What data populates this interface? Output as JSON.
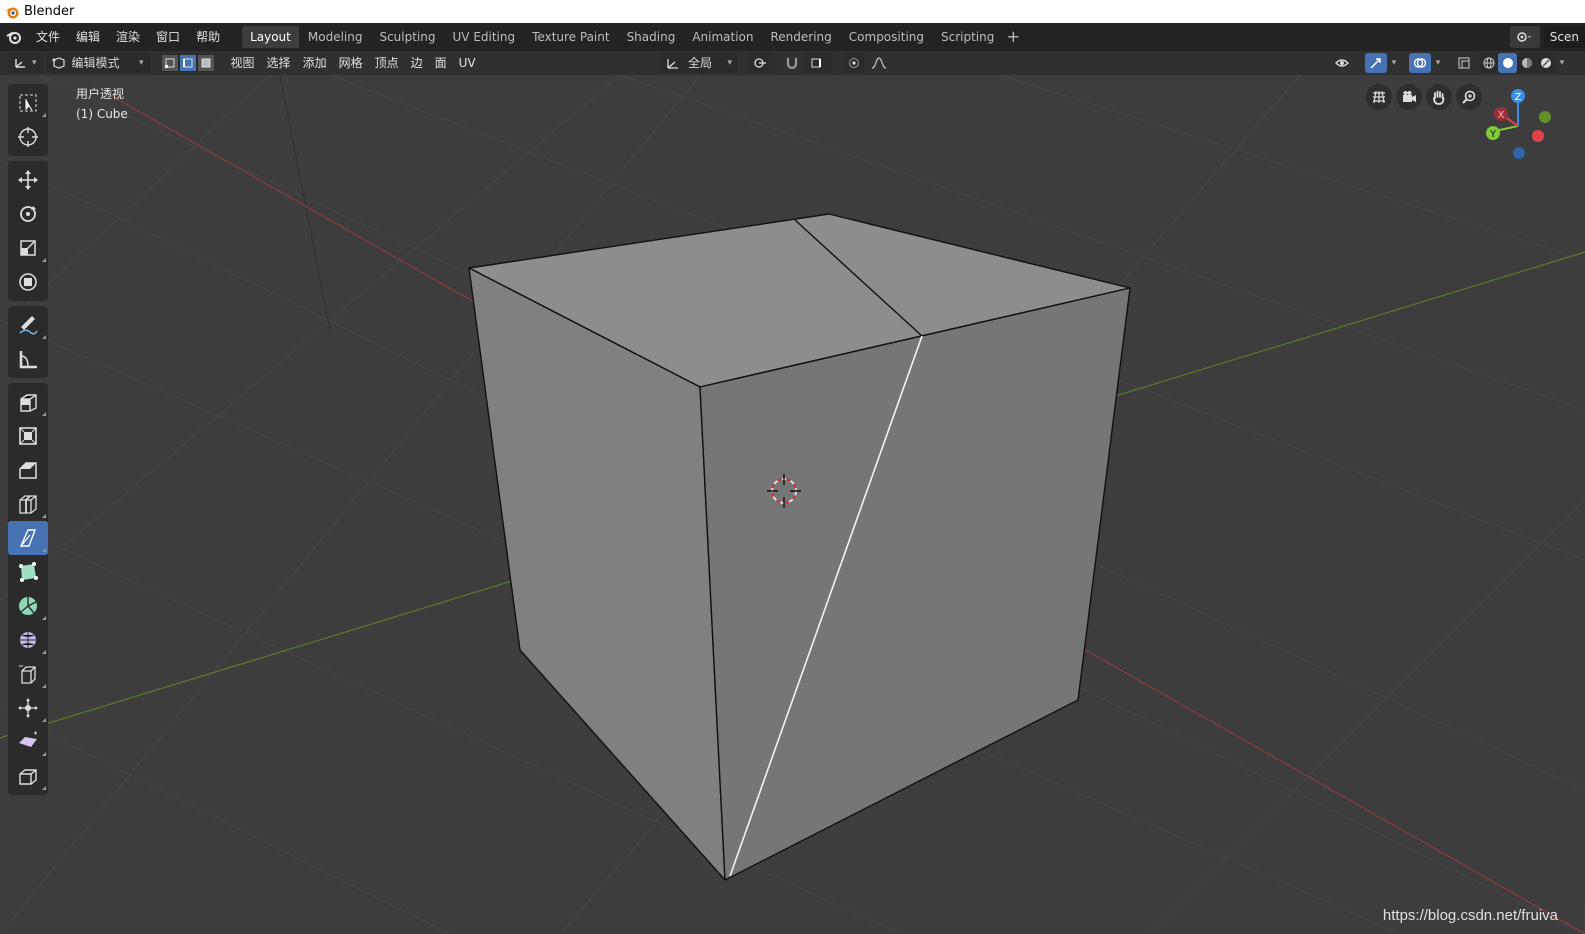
{
  "window": {
    "title": "Blender"
  },
  "menu": [
    "文件",
    "编辑",
    "渲染",
    "窗口",
    "帮助"
  ],
  "workspaces": [
    "Layout",
    "Modeling",
    "Sculpting",
    "UV Editing",
    "Texture Paint",
    "Shading",
    "Animation",
    "Rendering",
    "Compositing",
    "Scripting"
  ],
  "active_workspace": "Layout",
  "scene_label": "Scen",
  "header": {
    "mode": "编辑模式",
    "menus": [
      "视图",
      "选择",
      "添加",
      "网格",
      "顶点",
      "边",
      "面",
      "UV"
    ],
    "transform_orientation": "全局",
    "select_mode_active": "edge"
  },
  "overlay": {
    "view_name": "用户透视",
    "object_name": "(1) Cube"
  },
  "gizmo": {
    "x": "X",
    "y": "Y",
    "z": "Z"
  },
  "toolbar": {
    "groups": [
      [
        "select-box-tool",
        "cursor-tool"
      ],
      [
        "move-tool",
        "rotate-tool",
        "scale-tool",
        "transform-tool"
      ],
      [
        "annotate-tool",
        "measure-tool"
      ],
      [
        "extrude-region-tool",
        "inset-faces-tool",
        "bevel-tool",
        "loop-cut-tool",
        "knife-tool",
        "poly-build-tool",
        "spin-tool",
        "smooth-tool",
        "edge-slide-tool",
        "shrink-fatten-tool",
        "shear-tool",
        "rip-region-tool"
      ]
    ],
    "active": "knife-tool"
  },
  "colors": {
    "accent": "#4772b3",
    "x_axis": "#e0414d",
    "y_axis": "#7ecb35",
    "z_axis": "#3a8ee6"
  },
  "watermark": "https://blog.csdn.net/fruiva"
}
